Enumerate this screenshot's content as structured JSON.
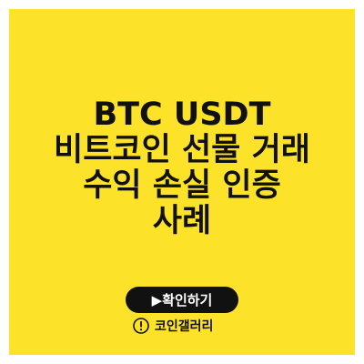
{
  "title": {
    "line1": "BTC USDT",
    "line2": "비트코인 선물 거래",
    "line3": "수익 손실 인증",
    "line4": "사례"
  },
  "cta": {
    "label": "▶확인하기"
  },
  "source": {
    "icon": "exclamation-circle-icon",
    "label": "코인갤러리"
  },
  "colors": {
    "background": "#fde22a",
    "text": "#111111",
    "button": "#111111",
    "button_text": "#ffffff"
  }
}
